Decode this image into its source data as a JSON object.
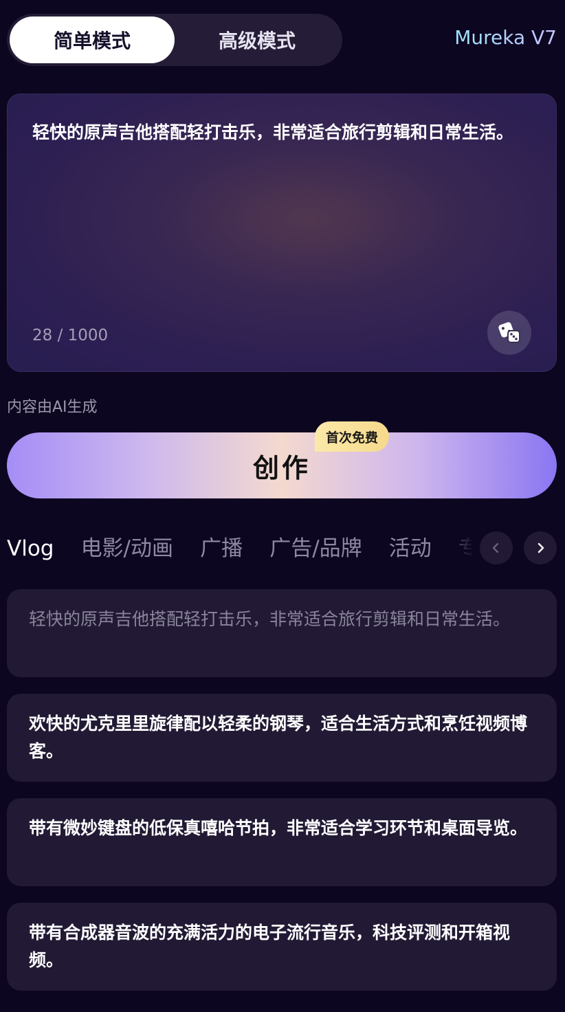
{
  "mode_switch": {
    "simple_label": "简单模式",
    "advanced_label": "高级模式",
    "active": "simple"
  },
  "version_label": "Mureka V7",
  "prompt": {
    "text": "轻快的原声吉他搭配轻打击乐，非常适合旅行剪辑和日常生活。",
    "char_count": "28 / 1000"
  },
  "ai_note": "内容由AI生成",
  "create_button": {
    "label": "创作",
    "badge": "首次免费"
  },
  "tabs": [
    "Vlog",
    "电影/动画",
    "广播",
    "广告/品牌",
    "活动",
    "专"
  ],
  "active_tab": "Vlog",
  "suggestions": [
    "轻快的原声吉他搭配轻打击乐，非常适合旅行剪辑和日常生活。",
    "欢快的尤克里里旋律配以轻柔的钢琴，适合生活方式和烹饪视频博客。",
    "带有微妙键盘的低保真嘻哈节拍，非常适合学习环节和桌面导览。",
    "带有合成器音波的充满活力的电子流行音乐，科技评测和开箱视频。"
  ],
  "icons": {
    "dice": "dice-icon",
    "prev": "chevron-left-icon",
    "next": "chevron-right-icon"
  }
}
